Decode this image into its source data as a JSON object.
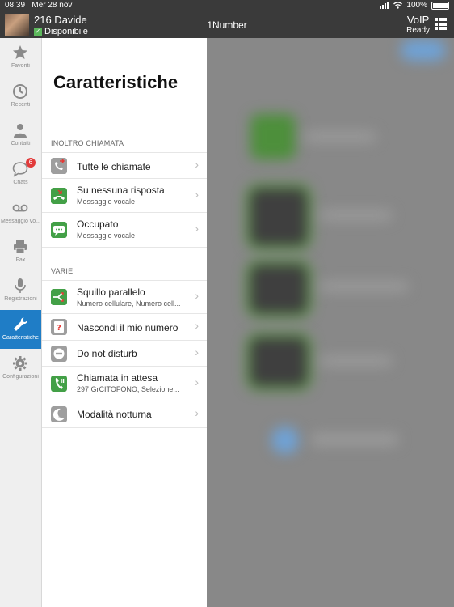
{
  "status_bar": {
    "time": "08:39",
    "date": "Mer 28 nov",
    "battery": "100%"
  },
  "header": {
    "user_name": "216 Davide",
    "user_status": "Disponibile",
    "app_title": "1Number",
    "voip_label": "VoIP",
    "voip_status": "Ready"
  },
  "sidebar": {
    "items": [
      {
        "label": "Favoriti",
        "icon": "star-icon"
      },
      {
        "label": "Recenti",
        "icon": "clock-icon"
      },
      {
        "label": "Contatti",
        "icon": "person-icon"
      },
      {
        "label": "Chats",
        "icon": "chat-bubble-icon",
        "badge": "6"
      },
      {
        "label": "Messaggio vo...",
        "icon": "voicemail-icon"
      },
      {
        "label": "Fax",
        "icon": "printer-icon"
      },
      {
        "label": "Registrazioni",
        "icon": "microphone-icon"
      },
      {
        "label": "Caratteristiche",
        "icon": "wrench-icon",
        "active": true
      },
      {
        "label": "Configurazioni",
        "icon": "gear-icon"
      }
    ]
  },
  "panel": {
    "title": "Caratteristiche",
    "sections": [
      {
        "heading": "INOLTRO CHIAMATA",
        "rows": [
          {
            "title": "Tutte le chiamate",
            "subtitle": "",
            "icon": "call-forward-all-icon"
          },
          {
            "title": "Su nessuna risposta",
            "subtitle": "Messaggio vocale",
            "icon": "call-forward-no-answer-icon"
          },
          {
            "title": "Occupato",
            "subtitle": "Messaggio vocale",
            "icon": "call-forward-busy-icon"
          }
        ]
      },
      {
        "heading": "VARIE",
        "rows": [
          {
            "title": "Squillo parallelo",
            "subtitle": "Numero cellulare, Numero cell...",
            "icon": "parallel-ring-icon"
          },
          {
            "title": "Nascondi il mio numero",
            "subtitle": "",
            "icon": "hide-number-icon"
          },
          {
            "title": "Do not disturb",
            "subtitle": "",
            "icon": "do-not-disturb-icon"
          },
          {
            "title": "Chiamata in attesa",
            "subtitle": "297 GrCITOFONO, Selezione...",
            "icon": "call-waiting-icon"
          },
          {
            "title": "Modalità notturna",
            "subtitle": "",
            "icon": "night-mode-icon"
          }
        ]
      }
    ]
  },
  "colors": {
    "accent": "#1f7dc6",
    "badge": "#e23b3b",
    "header_bg": "#3a3a3a",
    "green": "#4caf50"
  }
}
